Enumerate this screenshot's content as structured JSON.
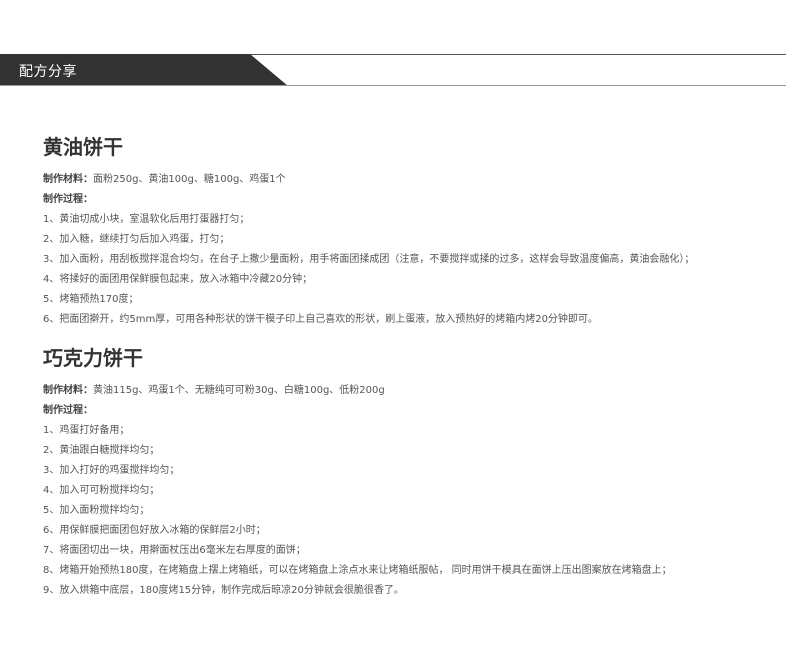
{
  "header": {
    "title": "配方分享"
  },
  "recipes": [
    {
      "title": "黄油饼干",
      "materials_label": "制作材料：",
      "materials": "面粉250g、黄油100g、糖100g、鸡蛋1个",
      "process_label": "制作过程：",
      "steps": [
        "1、黄油切成小块，室温软化后用打蛋器打匀；",
        "2、加入糖，继续打匀后加入鸡蛋，打匀；",
        "3、加入面粉，用刮板搅拌混合均匀，在台子上撒少量面粉，用手将面团揉成团（注意，不要搅拌或揉的过多，这样会导致温度偏高，黄油会融化）；",
        "4、将揉好的面团用保鲜膜包起来，放入冰箱中冷藏20分钟；",
        "5、烤箱预热170度；",
        "6、把面团擀开，约5mm厚，可用各种形状的饼干模子印上自己喜欢的形状，刷上蛋液，放入预热好的烤箱内烤20分钟即可。"
      ]
    },
    {
      "title": "巧克力饼干",
      "materials_label": "制作材料：",
      "materials": "黄油115g、鸡蛋1个、无糖纯可可粉30g、白糖100g、低粉200g",
      "process_label": "制作过程：",
      "steps": [
        "1、鸡蛋打好备用；",
        "2、黄油跟白糖搅拌均匀；",
        "3、加入打好的鸡蛋搅拌均匀；",
        "4、加入可可粉搅拌均匀；",
        "5、加入面粉搅拌均匀；",
        "6、用保鲜膜把面团包好放入冰箱的保鲜层2小时；",
        "7、将面团切出一块，用擀面杖压出6毫米左右厚度的面饼；",
        "8、烤箱开始预热180度，在烤箱盘上摆上烤箱纸，可以在烤箱盘上涂点水来让烤箱纸服帖， 同时用饼干模具在面饼上压出图案放在烤箱盘上；",
        "9、放入烘箱中底层，180度烤15分钟，制作完成后晾凉20分钟就会很脆很香了。"
      ]
    }
  ]
}
